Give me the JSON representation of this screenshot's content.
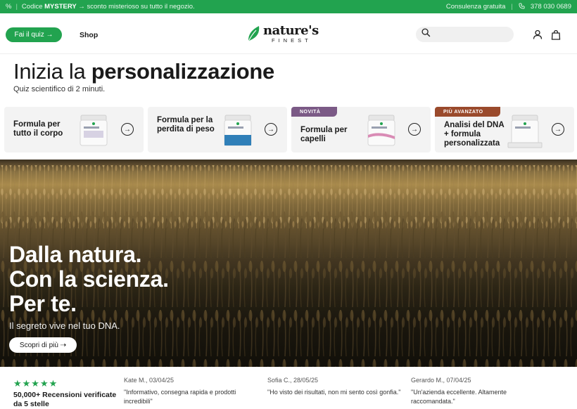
{
  "topbar": {
    "percent_symbol": "%",
    "promo_prefix": "Codice",
    "promo_code": "MYSTERY",
    "promo_suffix": "→ sconto misterioso su tutto il negozio.",
    "consult_label": "Consulenza gratuita",
    "phone": "378 030 0689"
  },
  "header": {
    "quiz_button": "Fai il quiz →",
    "shop_link": "Shop",
    "logo_main": "nature's",
    "logo_sub": "FINEST",
    "search_placeholder": ""
  },
  "personalization": {
    "title_light": "Inizia la ",
    "title_bold": "personalizzazione",
    "subtitle": "Quiz scientifico di 2 minuti."
  },
  "cards": [
    {
      "label": "Formula per tutto il corpo",
      "badge": ""
    },
    {
      "label": "Formula per la perdita di peso",
      "badge": ""
    },
    {
      "label": "Formula per capelli",
      "badge": "NOVITÀ"
    },
    {
      "label": "Analisi del DNA + formula personalizzata",
      "badge": "PIÙ AVANZATO"
    }
  ],
  "banner": {
    "headline_1": "Dalla natura.",
    "headline_2": "Con la scienza.",
    "headline_3": "Per te.",
    "tagline": "Il segreto vive nel tuo DNA.",
    "cta": "Scopri di più ⇢"
  },
  "reviews": {
    "stars": "★★★★★",
    "count_text": "50,000+ Recensioni verificate da 5 stelle",
    "items": [
      {
        "author": "Kate M., 03/04/25",
        "text": "\"Informativo, consegna rapida e prodotti incredibili\""
      },
      {
        "author": "Sofia C., 28/05/25",
        "text": "\"Ho visto dei risultati, non mi sento così gonfia.\""
      },
      {
        "author": "Gerardo M., 07/04/25",
        "text": "\"Un'azienda eccellente. Altamente raccomandata.\""
      }
    ]
  },
  "colors": {
    "brand_green": "#22a34f",
    "badge_new": "#7b5a86",
    "badge_advanced": "#9a4a2c"
  }
}
